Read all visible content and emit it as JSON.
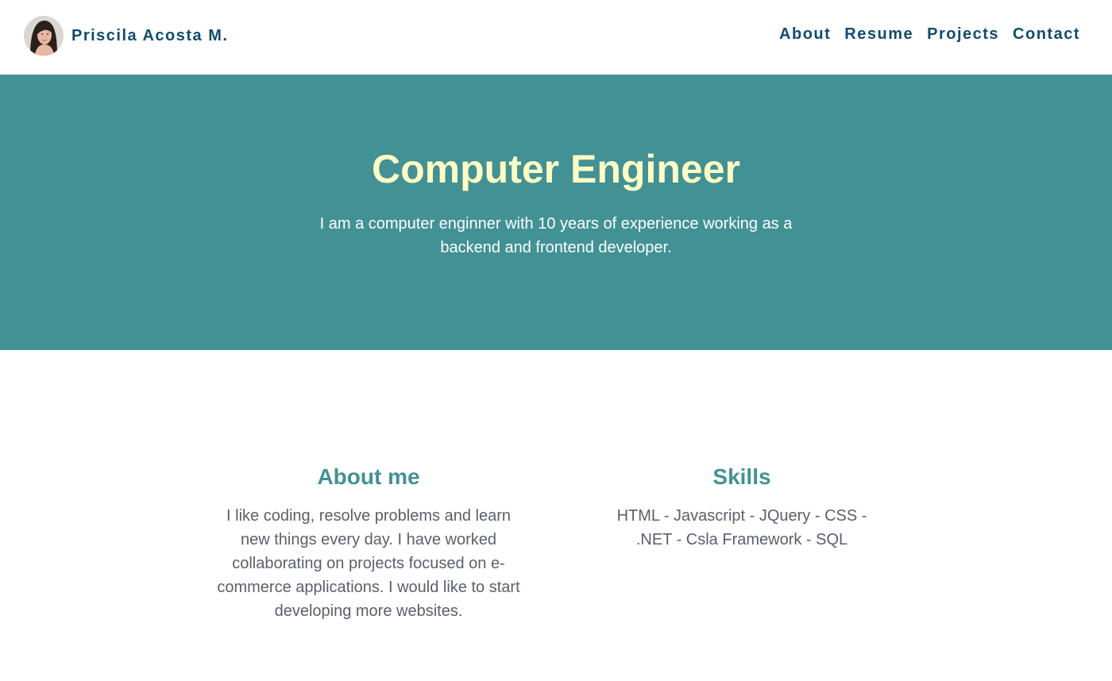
{
  "brand": {
    "name": "Priscila Acosta M."
  },
  "nav": {
    "items": [
      "About",
      "Resume",
      "Projects",
      "Contact"
    ]
  },
  "hero": {
    "title": "Computer Engineer",
    "description": "I am a computer enginner with 10 years of experience working as a backend and frontend developer."
  },
  "about": {
    "title": "About me",
    "text": "I like coding, resolve problems and learn new things every day. I have worked collaborating on projects focused on e-commerce applications. I would like to start developing more websites."
  },
  "skills": {
    "title": "Skills",
    "text": "HTML - Javascript - JQuery - CSS - .NET - Csla Framework - SQL"
  },
  "colors": {
    "nav_text": "#0f4c6e",
    "hero_bg": "#429195",
    "hero_title": "#fdfcc4",
    "section_title": "#429195",
    "body_text": "#5a5f6e"
  }
}
